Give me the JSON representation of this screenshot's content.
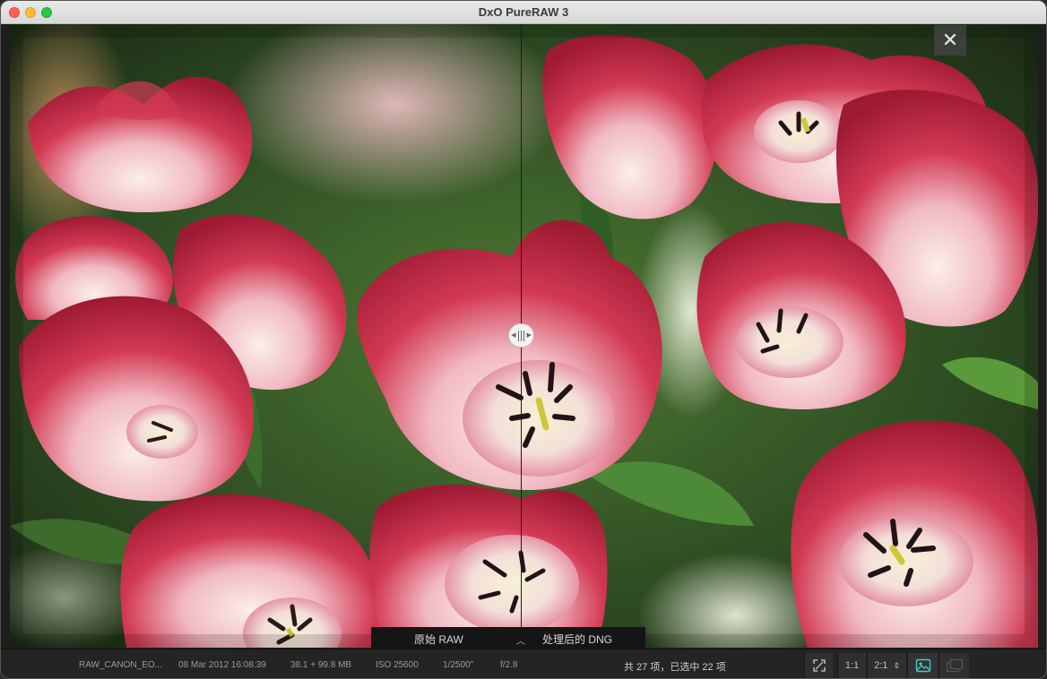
{
  "window": {
    "title": "DxO PureRAW 3"
  },
  "viewer": {
    "close_symbol": "✕",
    "left_label": "原始 RAW",
    "right_label": "处理后的 DNG",
    "expand_symbol": "︿"
  },
  "status": {
    "filename": "RAW_CANON_EO...",
    "date": "08 Mar 2012 16:08:39",
    "size": "38.1 + 99.8 MB",
    "iso": "ISO 25600",
    "shutter": "1/2500\"",
    "aperture": "f/2.8",
    "selection": "共 27 项，已选中 22 项"
  },
  "toolbar": {
    "fit_icon": "fit-to-screen-icon",
    "zoom_1_1": "1:1",
    "zoom_2_1": "2:1",
    "stepper_symbol": "⇕",
    "single_view_icon": "single-image-icon",
    "compare_view_icon": "side-by-side-icon"
  },
  "colors": {
    "petal_red": "#c8263f",
    "petal_pink": "#ec8aa0",
    "petal_white": "#f6e9e6",
    "leaf_green": "#3b7a2b",
    "accent_teal": "#3fd0c2"
  }
}
